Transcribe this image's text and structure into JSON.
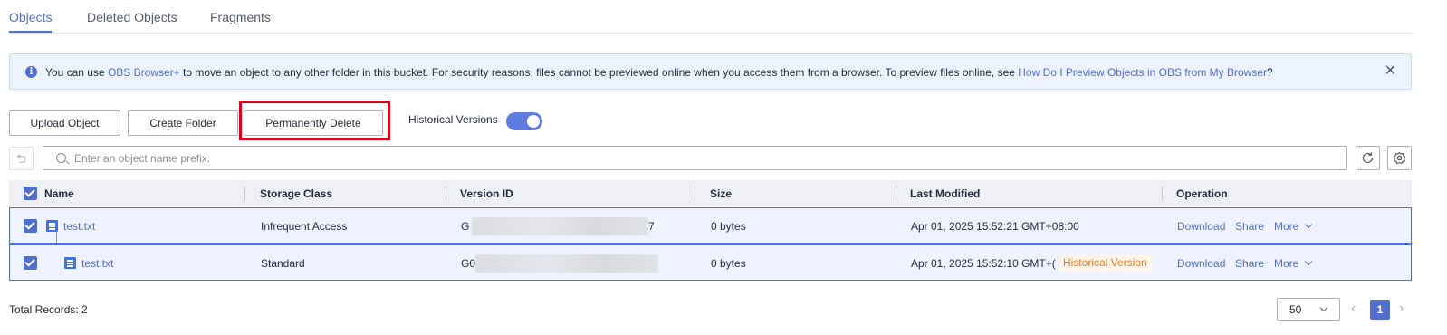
{
  "tabs": [
    {
      "label": "Objects",
      "active": true
    },
    {
      "label": "Deleted Objects",
      "active": false
    },
    {
      "label": "Fragments",
      "active": false
    }
  ],
  "banner": {
    "text_1": "You can use ",
    "link_1": "OBS Browser+",
    "text_2": " to move an object to any other folder in this bucket. For security reasons, files cannot be previewed online when you access them from a browser. To preview files online, see ",
    "link_2": "How Do I Preview Objects in OBS from My Browser",
    "text_3": "?",
    "close_icon": "close-icon",
    "info_icon": "info-icon"
  },
  "toolbar": {
    "upload_label": "Upload Object",
    "create_folder_label": "Create Folder",
    "permanently_delete_label": "Permanently Delete",
    "historical_versions_label": "Historical Versions",
    "historical_versions_on": true
  },
  "search": {
    "placeholder": "Enter an object name prefix.",
    "value": ""
  },
  "table": {
    "columns": [
      "Name",
      "Storage Class",
      "Version ID",
      "Size",
      "Last Modified",
      "Operation"
    ],
    "rows": [
      {
        "name": "test.txt",
        "storage_class": "Infrequent Access",
        "version_id_prefix": "G",
        "version_id_suffix": "7",
        "size": "0 bytes",
        "last_modified": "Apr 01, 2025 15:52:21 GMT+08:00",
        "tag": "",
        "checked": true,
        "ops": [
          "Download",
          "Share",
          "More"
        ]
      },
      {
        "name": "test.txt",
        "storage_class": "Standard",
        "version_id_prefix": "G0",
        "version_id_suffix": "",
        "size": "0 bytes",
        "last_modified": "Apr 01, 2025 15:52:10 GMT+(",
        "tag": "Historical Version",
        "checked": true,
        "ops": [
          "Download",
          "Share",
          "More"
        ]
      }
    ]
  },
  "footer": {
    "total_records": "Total Records: 2",
    "page_size": "50",
    "current_page": "1"
  },
  "colors": {
    "accent": "#526ecc",
    "highlight": "#e1001b",
    "tag_text": "#e37d29",
    "tag_bg": "#fff4e5"
  }
}
